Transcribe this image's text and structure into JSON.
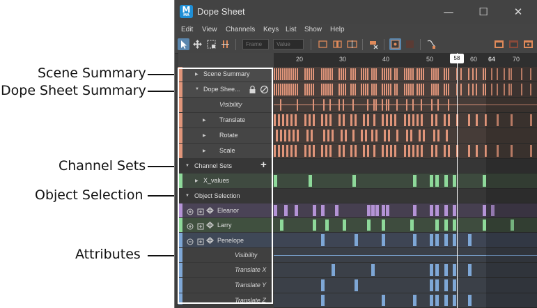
{
  "callouts": [
    {
      "label": "Scene Summary"
    },
    {
      "label": "Dope Sheet Summary"
    },
    {
      "label": "Channel Sets"
    },
    {
      "label": "Object Selection"
    },
    {
      "label": "Attributes"
    }
  ],
  "window": {
    "title": "Dope Sheet",
    "icon_letter": "M",
    "icon_sub": "MA",
    "controls": {
      "minimize": "—",
      "maximize": "☐",
      "close": "✕"
    }
  },
  "menu": [
    "Edit",
    "View",
    "Channels",
    "Keys",
    "List",
    "Show",
    "Help"
  ],
  "toolbar": {
    "frame_placeholder": "Frame",
    "value_placeholder": "Value"
  },
  "outliner": {
    "rows": [
      {
        "label": "Scene Summary",
        "arrow": "▶",
        "italic": false
      },
      {
        "label": "Dope Shee...",
        "arrow": "▼",
        "italic": false
      },
      {
        "label": "Visibility",
        "arrow": "",
        "italic": true
      },
      {
        "label": "Translate",
        "arrow": "▶",
        "italic": false
      },
      {
        "label": "Rotate",
        "arrow": "▶",
        "italic": false
      },
      {
        "label": "Scale",
        "arrow": "▶",
        "italic": false
      },
      {
        "label": "Channel Sets",
        "arrow": "▼",
        "italic": false,
        "plus": "+"
      },
      {
        "label": "X_values",
        "arrow": "▶",
        "italic": false
      },
      {
        "label": "Object Selection",
        "arrow": "▼",
        "italic": false
      },
      {
        "label": "Eleanor",
        "arrow": "",
        "italic": false
      },
      {
        "label": "Larry",
        "arrow": "",
        "italic": false
      },
      {
        "label": "Penelope",
        "arrow": "",
        "italic": false
      },
      {
        "label": "Visibility",
        "arrow": "",
        "italic": true
      },
      {
        "label": "Translate X",
        "arrow": "",
        "italic": true
      },
      {
        "label": "Translate Y",
        "arrow": "",
        "italic": true
      },
      {
        "label": "Translate Z",
        "arrow": "",
        "italic": true
      }
    ]
  },
  "timeline": {
    "ticks": [
      "20",
      "30",
      "40",
      "50",
      "60",
      "64",
      "70"
    ],
    "current_frame": "58"
  },
  "colors": {
    "summary": "#e0957a",
    "channel_set": "#8ed99a",
    "eleanor": "#b493d6",
    "larry": "#8ed99a",
    "penelope": "#7ea7d6"
  }
}
